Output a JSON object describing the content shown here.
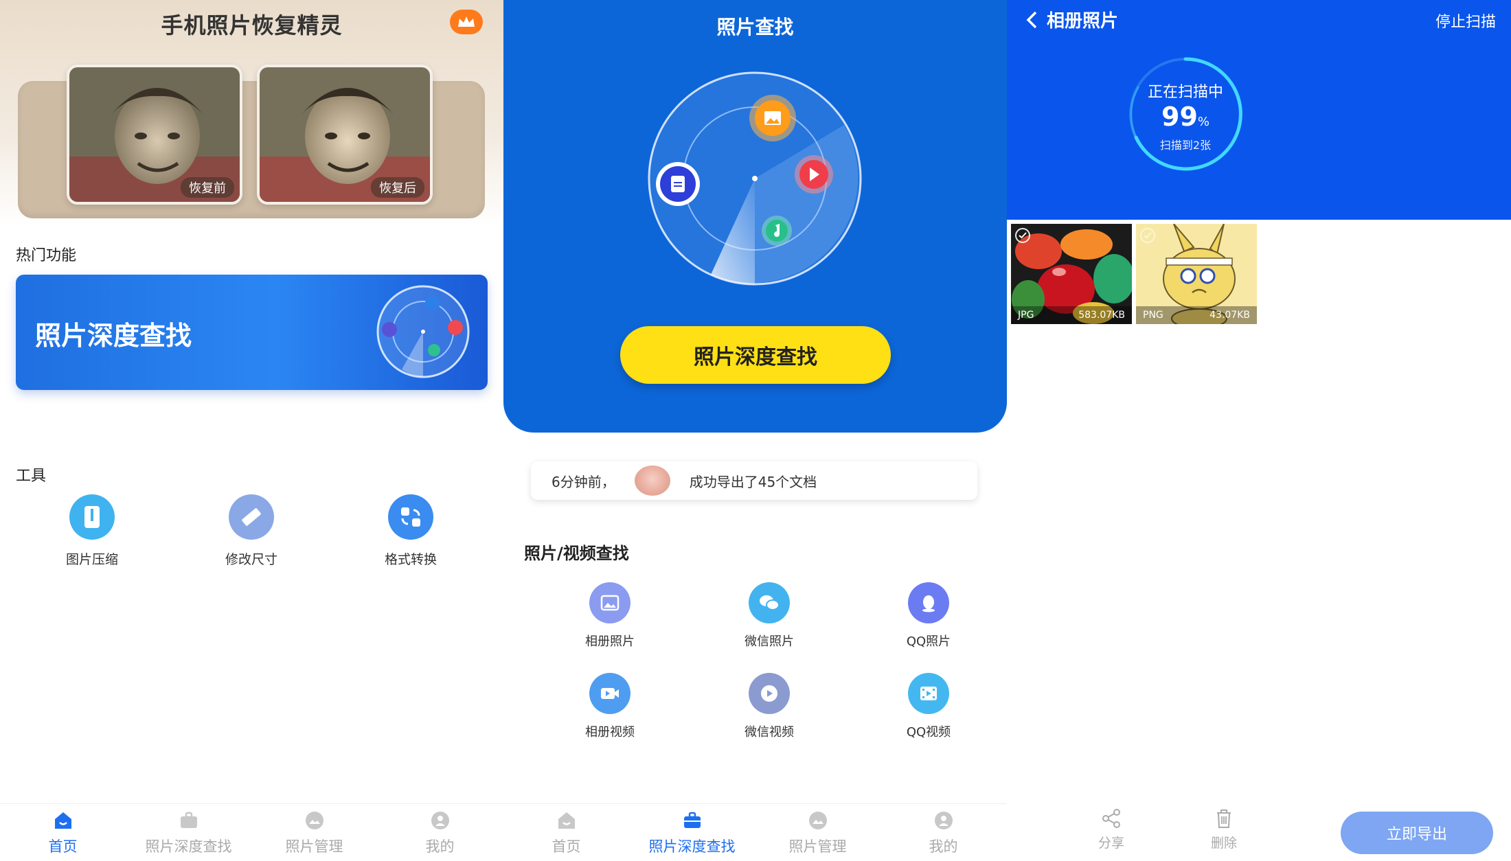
{
  "panel1": {
    "title": "手机照片恢复精灵",
    "photo_before_label": "恢复前",
    "photo_after_label": "恢复后",
    "hot_label": "热门功能",
    "deep_banner_label": "照片深度查找",
    "tools_label": "工具",
    "tools": [
      {
        "label": "图片压缩",
        "icon": "compress-icon",
        "color": "#3fb3f0"
      },
      {
        "label": "修改尺寸",
        "icon": "ruler-icon",
        "color": "#8aa8e6"
      },
      {
        "label": "格式转换",
        "icon": "convert-icon",
        "color": "#3a8cf0"
      }
    ],
    "nav": [
      {
        "label": "首页",
        "active": true
      },
      {
        "label": "照片深度查找",
        "active": false
      },
      {
        "label": "照片管理",
        "active": false
      },
      {
        "label": "我的",
        "active": false
      }
    ]
  },
  "panel2": {
    "title": "照片查找",
    "button_label": "照片深度查找",
    "ticker": {
      "time": "6分钟前，",
      "message": "成功导出了45个文档"
    },
    "section_label": "照片/视频查找",
    "items": [
      {
        "label": "相册照片",
        "icon": "album-photo-icon",
        "color": "#8b9bf0"
      },
      {
        "label": "微信照片",
        "icon": "wechat-photo-icon",
        "color": "#43b3ef"
      },
      {
        "label": "QQ照片",
        "icon": "qq-photo-icon",
        "color": "#6b7cf2"
      },
      {
        "label": "相册视频",
        "icon": "album-video-icon",
        "color": "#4f9df0"
      },
      {
        "label": "微信视频",
        "icon": "wechat-video-icon",
        "color": "#8b9bd0"
      },
      {
        "label": "QQ视频",
        "icon": "qq-video-icon",
        "color": "#43b8f0"
      }
    ],
    "nav": [
      {
        "label": "首页",
        "active": false
      },
      {
        "label": "照片深度查找",
        "active": true
      },
      {
        "label": "照片管理",
        "active": false
      },
      {
        "label": "我的",
        "active": false
      }
    ]
  },
  "panel3": {
    "back_label": "相册照片",
    "stop_label": "停止扫描",
    "scan_status": "正在扫描中",
    "scan_percent": "99",
    "scan_percent_unit": "%",
    "scan_count": "扫描到2张",
    "thumbs": [
      {
        "type": "JPG",
        "size": "583.07KB"
      },
      {
        "type": "PNG",
        "size": "43.07KB"
      }
    ],
    "share_label": "分享",
    "delete_label": "删除",
    "export_label": "立即导出"
  },
  "colors": {
    "blue": "#0d66d8",
    "yellow": "#ffe014",
    "nav_active": "#1e6ff0",
    "crown": "#ff7a1a"
  }
}
